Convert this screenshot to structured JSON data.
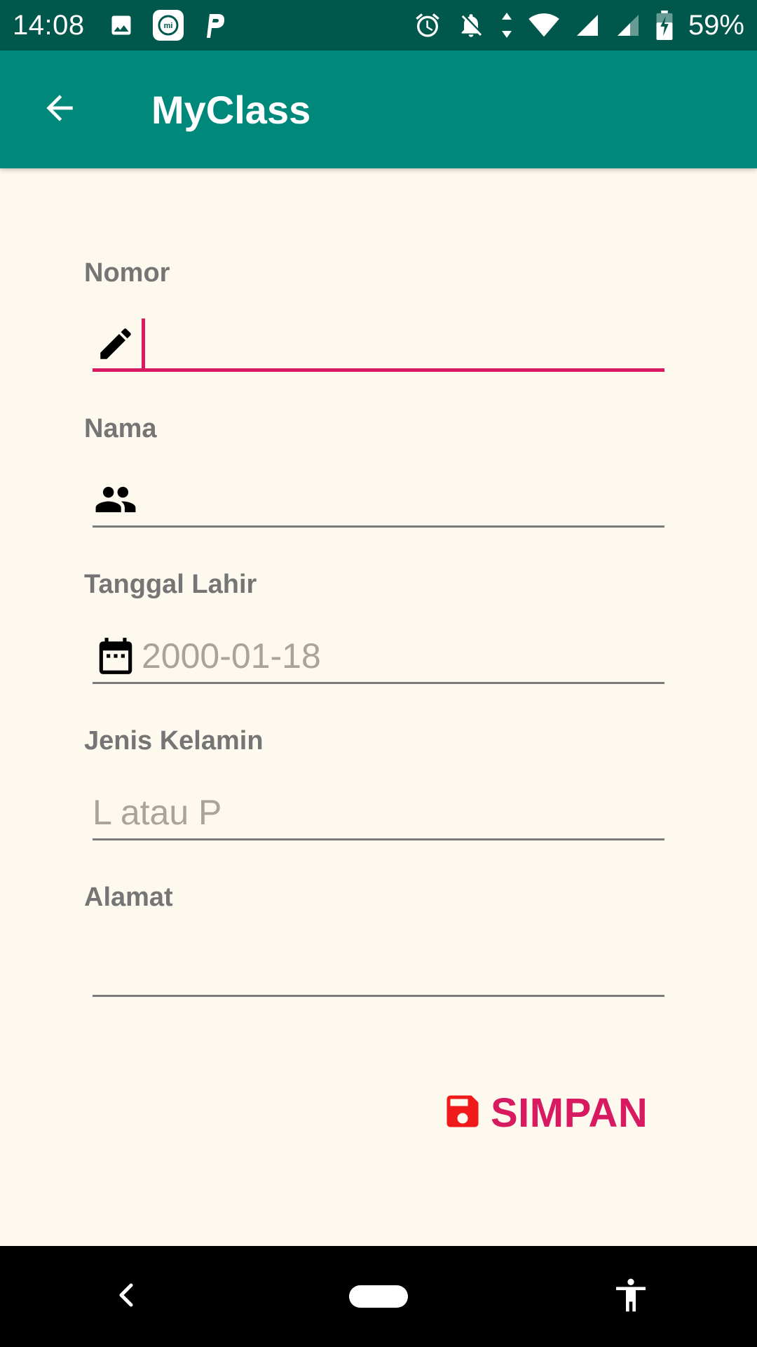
{
  "status_bar": {
    "time": "14:08",
    "battery": "59%",
    "left_icons": [
      "image-icon",
      "mi-icon",
      "p-icon"
    ],
    "right_icons": [
      "alarm-icon",
      "notifications-off-icon",
      "data-arrows-icon",
      "wifi-icon",
      "signal-icon",
      "signal-icon-2",
      "battery-charging-icon"
    ]
  },
  "app_bar": {
    "title": "MyClass",
    "back_icon": "arrow-back-icon"
  },
  "form": {
    "fields": [
      {
        "label": "Nomor",
        "placeholder": "",
        "value": "",
        "icon": "pencil-icon",
        "focused": true
      },
      {
        "label": "Nama",
        "placeholder": "",
        "value": "",
        "icon": "people-icon"
      },
      {
        "label": "Tanggal Lahir",
        "placeholder": "2000-01-18",
        "value": "",
        "icon": "calendar-icon"
      },
      {
        "label": "Jenis Kelamin",
        "placeholder": "L atau P",
        "value": ""
      },
      {
        "label": "Alamat",
        "placeholder": "",
        "value": ""
      }
    ]
  },
  "save_button": {
    "label": "SIMPAN",
    "icon": "save-icon",
    "icon_color": "#f01a1a",
    "text_color": "#d81b60"
  },
  "colors": {
    "status_bar": "#00574b",
    "app_bar": "#00897b",
    "background": "#fdf9ef",
    "accent": "#d81b60"
  },
  "nav_bar": {
    "buttons": [
      "nav-back-icon",
      "home-pill",
      "accessibility-icon"
    ]
  }
}
